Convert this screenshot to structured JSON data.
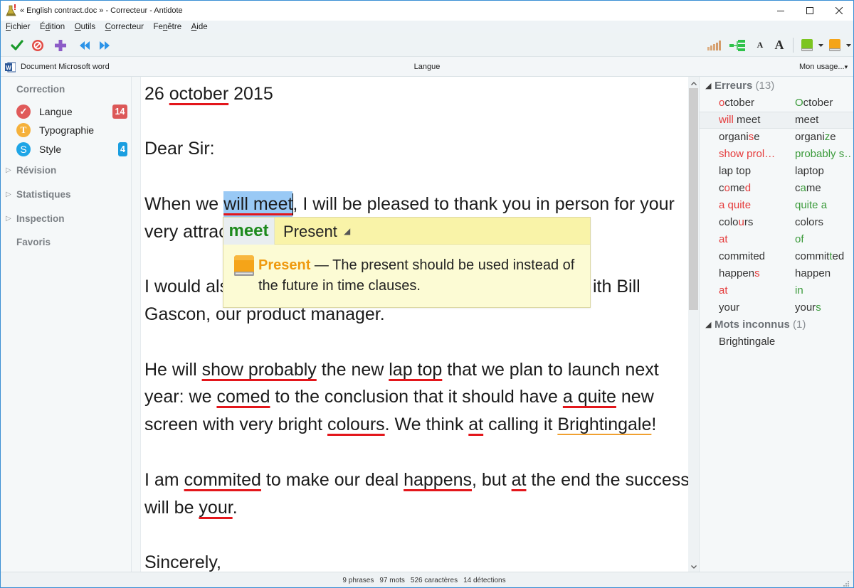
{
  "window": {
    "title": "« English contract.doc » - Correcteur - Antidote"
  },
  "menu": [
    {
      "label": "Fichier",
      "key": 0
    },
    {
      "label": "Édition",
      "key": 1
    },
    {
      "label": "Outils",
      "key": 0
    },
    {
      "label": "Correcteur",
      "key": 0
    },
    {
      "label": "Fenêtre",
      "key": 2
    },
    {
      "label": "Aide",
      "key": 0
    }
  ],
  "toolbar": {
    "left_icons": [
      "accept-correction-icon",
      "ignore-detection-icon",
      "add-icon",
      "previous-detection-icon",
      "next-detection-icon"
    ],
    "right_icons": [
      "statistics-icon",
      "tree-view-icon",
      "text-smaller-icon",
      "text-larger-icon",
      "dictionaries-book-icon",
      "guides-book-icon"
    ],
    "text_small": "A",
    "text_large": "A"
  },
  "infobar": {
    "document_type": "Document Microsoft word",
    "language": "Langue",
    "usage": "Mon usage...",
    "usage_arrow": "▾"
  },
  "sidebar": {
    "correction_heading": "Correction",
    "filters": [
      {
        "label": "Langue",
        "glyph": "✓",
        "count": "14"
      },
      {
        "label": "Typographie",
        "glyph": "T",
        "count": ""
      },
      {
        "label": "Style",
        "glyph": "S",
        "count": "4"
      }
    ],
    "sections": [
      {
        "label": "Révision",
        "expander": "▷"
      },
      {
        "label": "Statistiques",
        "expander": "▷"
      },
      {
        "label": "Inspection",
        "expander": "▷"
      }
    ],
    "favorites": "Favoris"
  },
  "document": {
    "lines": [
      [
        "26 ",
        {
          "t": "october",
          "mark": "error"
        },
        " 2015"
      ],
      [],
      [
        "Dear Sir:"
      ],
      [],
      [
        "When we ",
        {
          "t": "will meet",
          "mark": "error",
          "selected": true,
          "caret_after": true
        },
        ", I will be pleased to thank you in person for your"
      ],
      [
        "very attrac"
      ],
      [],
      [
        "I would als",
        {
          "t": "ith Bill",
          "after_occlusion": true
        }
      ],
      [
        "Gascon, our product manager."
      ],
      [],
      [
        "He will ",
        {
          "t": "show probably",
          "mark": "error"
        },
        " the new ",
        {
          "t": "lap top",
          "mark": "error"
        },
        " that we plan to launch next"
      ],
      [
        "year: we ",
        {
          "t": "comed",
          "mark": "error"
        },
        " to the conclusion that it should have ",
        {
          "t": "a quite",
          "mark": "error"
        },
        " new"
      ],
      [
        "screen with very bright ",
        {
          "t": "colours",
          "mark": "error"
        },
        ". We think ",
        {
          "t": "at",
          "mark": "error"
        },
        " calling it ",
        {
          "t": "Brightingale",
          "mark": "unknown"
        },
        "!"
      ],
      [],
      [
        "I am ",
        {
          "t": "commited",
          "mark": "error"
        },
        " to make our deal ",
        {
          "t": "happens",
          "mark": "error"
        },
        ", but ",
        {
          "t": "at",
          "mark": "error"
        },
        " the end the success"
      ],
      [
        "will be ",
        {
          "t": "your",
          "mark": "error"
        },
        "."
      ],
      [],
      [
        "Sincerely,"
      ]
    ]
  },
  "popup": {
    "replacement": "meet",
    "rule": "Present",
    "rule_expander": "◢",
    "explanation_title": "Present",
    "explanation_text": " — The present should be used instead of the future in time clauses."
  },
  "panel": {
    "errors_heading": "Erreurs",
    "errors_count": " (13)",
    "expander": "◢",
    "errors": [
      {
        "original": [
          [
            "o",
            "error"
          ],
          [
            "ctober",
            "plain"
          ]
        ],
        "correction": [
          [
            "O",
            "fix"
          ],
          [
            "ctober",
            "plain"
          ]
        ]
      },
      {
        "original": [
          [
            "will",
            "error"
          ],
          [
            " meet",
            "plain"
          ]
        ],
        "correction": [
          [
            "meet",
            "plain"
          ]
        ],
        "selected": true
      },
      {
        "original": [
          [
            "organi",
            "plain"
          ],
          [
            "s",
            "error"
          ],
          [
            "e",
            "plain"
          ]
        ],
        "correction": [
          [
            "organi",
            "plain"
          ],
          [
            "z",
            "fix"
          ],
          [
            "e",
            "plain"
          ]
        ]
      },
      {
        "original": [
          [
            "show prol…",
            "error"
          ]
        ],
        "correction": [
          [
            "probably s…",
            "fix"
          ]
        ]
      },
      {
        "original": [
          [
            "lap top",
            "plain"
          ]
        ],
        "correction": [
          [
            "laptop",
            "plain"
          ]
        ]
      },
      {
        "original": [
          [
            "c",
            "plain"
          ],
          [
            "o",
            "error"
          ],
          [
            "me",
            "plain"
          ],
          [
            "d",
            "error"
          ]
        ],
        "correction": [
          [
            "c",
            "plain"
          ],
          [
            "a",
            "fix"
          ],
          [
            "me",
            "plain"
          ]
        ]
      },
      {
        "original": [
          [
            "a quite",
            "error"
          ]
        ],
        "correction": [
          [
            "quite a",
            "fix"
          ]
        ]
      },
      {
        "original": [
          [
            "colo",
            "plain"
          ],
          [
            "u",
            "error"
          ],
          [
            "rs",
            "plain"
          ]
        ],
        "correction": [
          [
            "colors",
            "plain"
          ]
        ]
      },
      {
        "original": [
          [
            "at",
            "error"
          ]
        ],
        "correction": [
          [
            "of",
            "fix"
          ]
        ]
      },
      {
        "original": [
          [
            "commited",
            "plain"
          ]
        ],
        "correction": [
          [
            "commit",
            "plain"
          ],
          [
            "t",
            "fix"
          ],
          [
            "ed",
            "plain"
          ]
        ]
      },
      {
        "original": [
          [
            "happen",
            "plain"
          ],
          [
            "s",
            "error"
          ]
        ],
        "correction": [
          [
            "happen",
            "plain"
          ]
        ]
      },
      {
        "original": [
          [
            "at",
            "error"
          ]
        ],
        "correction": [
          [
            "in",
            "fix"
          ]
        ]
      },
      {
        "original": [
          [
            "your",
            "plain"
          ]
        ],
        "correction": [
          [
            "your",
            "plain"
          ],
          [
            "s",
            "fix"
          ]
        ]
      }
    ],
    "unknown_heading": "Mots inconnus",
    "unknown_count": " (1)",
    "unknown": [
      "Brightingale"
    ]
  },
  "scroll": {
    "position_fraction": 0,
    "visible_fraction": 0.47
  },
  "status": {
    "sentences": "9 phrases",
    "words": "97 mots",
    "characters": "526 caractères",
    "detections": "14 détections"
  },
  "colors": {
    "langue": "#e05a5a",
    "typographie": "#f5b13b",
    "style": "#1ea5e6",
    "langue_badge": "#dc5858",
    "style_badge": "#1a9ee0",
    "error_underline": "#e3161b",
    "unknown_underline": "#f0a030",
    "selection": "#99c9f5"
  }
}
